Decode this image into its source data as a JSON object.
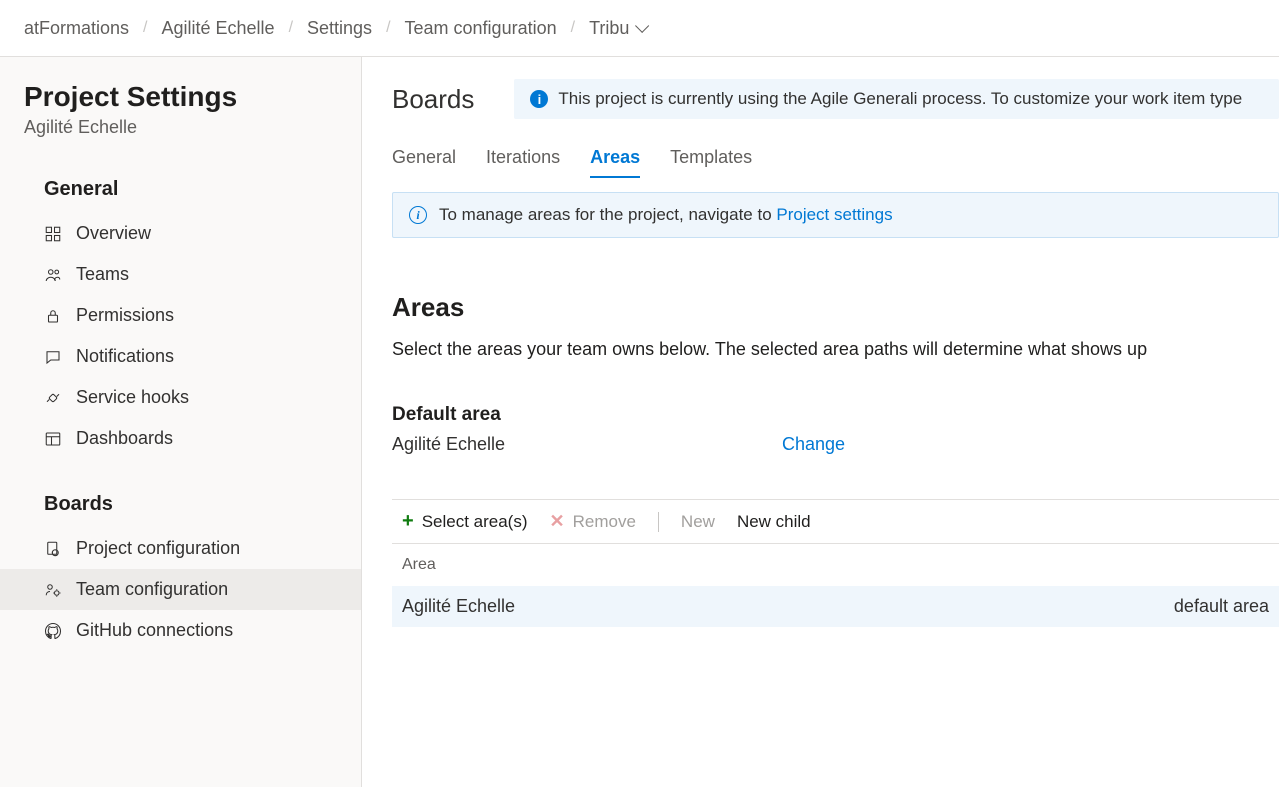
{
  "breadcrumb": {
    "items": [
      "atFormations",
      "Agilité Echelle",
      "Settings",
      "Team configuration"
    ],
    "last": "Tribu"
  },
  "sidebar": {
    "title": "Project Settings",
    "subtitle": "Agilité Echelle",
    "sections": {
      "general": {
        "head": "General",
        "items": [
          "Overview",
          "Teams",
          "Permissions",
          "Notifications",
          "Service hooks",
          "Dashboards"
        ]
      },
      "boards": {
        "head": "Boards",
        "items": [
          "Project configuration",
          "Team configuration",
          "GitHub connections"
        ]
      }
    }
  },
  "header": {
    "title": "Boards",
    "banner": "This project is currently using the Agile Generali process. To customize your work item type"
  },
  "tabs": [
    "General",
    "Iterations",
    "Areas",
    "Templates"
  ],
  "info_bar": {
    "text": "To manage areas for the project, navigate to ",
    "link": "Project settings"
  },
  "areas": {
    "title": "Areas",
    "desc": "Select the areas your team owns below. The selected area paths will determine what shows up",
    "default_label": "Default area",
    "default_name": "Agilité Echelle",
    "change": "Change"
  },
  "toolbar": {
    "select": "Select area(s)",
    "remove": "Remove",
    "new": "New",
    "new_child": "New child"
  },
  "table": {
    "head": "Area",
    "row_name": "Agilité Echelle",
    "row_tag": "default area"
  }
}
